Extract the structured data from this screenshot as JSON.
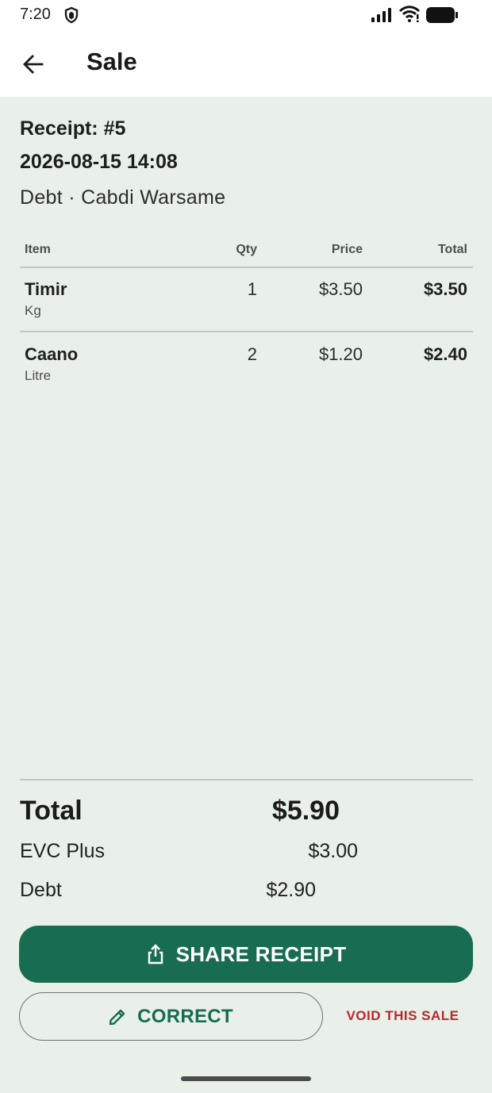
{
  "status_bar": {
    "time": "7:20"
  },
  "app_bar": {
    "title": "Sale"
  },
  "receipt": {
    "number_label": "Receipt: #5",
    "datetime": "2026-08-15  14:08",
    "meta": "Debt · Cabdi Warsame"
  },
  "table": {
    "headers": {
      "item": "Item",
      "qty": "Qty",
      "price": "Price",
      "total": "Total"
    },
    "rows": [
      {
        "name": "Timir",
        "unit": "Kg",
        "qty": "1",
        "price": "$3.50",
        "total": "$3.50"
      },
      {
        "name": "Caano",
        "unit": "Litre",
        "qty": "2",
        "price": "$1.20",
        "total": "$2.40"
      }
    ]
  },
  "summary": {
    "total_label": "Total",
    "total_value": "$5.90",
    "lines": [
      {
        "label": "EVC Plus",
        "value": "$3.00"
      },
      {
        "label": "Debt",
        "value": "$2.90"
      }
    ]
  },
  "actions": {
    "share_label": "SHARE RECEIPT",
    "correct_label": "CORRECT",
    "void_label": "VOID THIS SALE"
  },
  "colors": {
    "primary": "#186c52",
    "danger": "#b9282a",
    "background": "#e9efe9"
  }
}
